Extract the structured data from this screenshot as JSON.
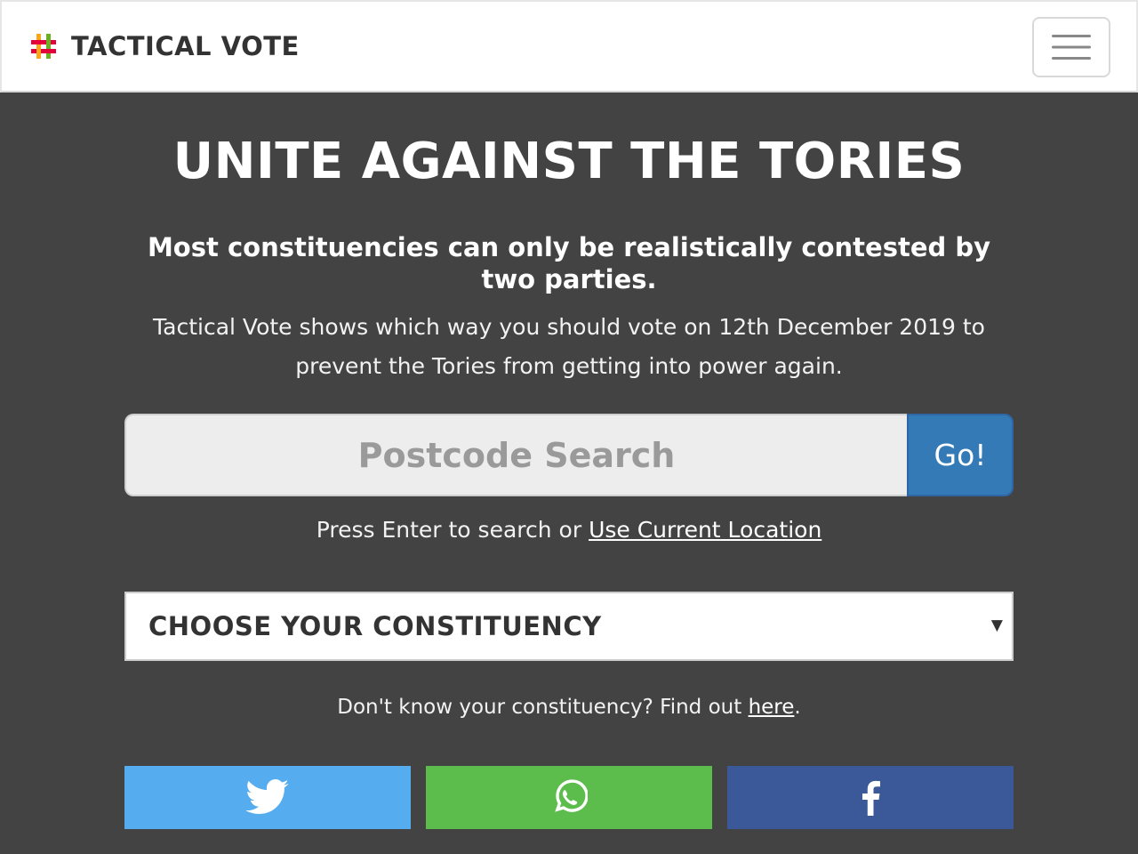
{
  "navbar": {
    "brand_name": "TACTICAL VOTE",
    "brand_symbol": "#",
    "menu_icon": "hamburger-menu-icon"
  },
  "hero": {
    "title": "UNITE AGAINST THE TORIES",
    "lead": "Most constituencies can only be realistically contested by two parties.",
    "description": "Tactical Vote shows which way you should vote on 12th December 2019 to prevent the Tories from getting into power again."
  },
  "search": {
    "placeholder": "Postcode Search",
    "value": "",
    "button_label": "Go!",
    "hint_prefix": "Press Enter to search or ",
    "hint_link": "Use Current Location"
  },
  "constituency": {
    "selected": "CHOOSE YOUR CONSTITUENCY",
    "caret": "▼",
    "help_prefix": "Don't know your constituency? Find out ",
    "help_link": "here",
    "help_suffix": "."
  },
  "share": [
    {
      "network": "twitter",
      "icon": "twitter-bird-icon",
      "color": "#55acee"
    },
    {
      "network": "whatsapp",
      "icon": "whatsapp-phone-icon",
      "color": "#5cbd4c"
    },
    {
      "network": "facebook",
      "icon": "facebook-f-icon",
      "color": "#3b5998"
    }
  ],
  "colors": {
    "background": "#434343",
    "navbar": "#ffffff",
    "go_button": "#337ab7",
    "logo": [
      "#e4003b",
      "#faa61a",
      "#6ab023",
      "#e4003b"
    ]
  }
}
